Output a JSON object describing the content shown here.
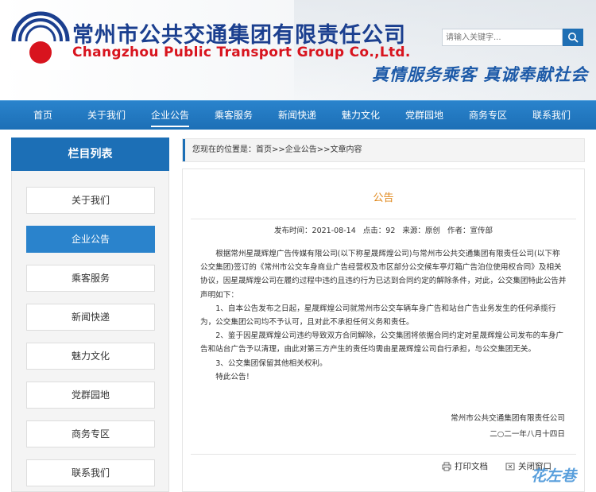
{
  "header": {
    "title_cn": "常州市公共交通集团有限责任公司",
    "title_en": "Changzhou Public Transport Group Co.,Ltd.",
    "search_placeholder": "请输入关键字...",
    "slogan": "真情服务乘客 真诚奉献社会",
    "logo_icon": "circle-logo-icon",
    "brand_blue": "#1b3f8f",
    "brand_red": "#d8141e"
  },
  "nav": {
    "items": [
      "首页",
      "关于我们",
      "企业公告",
      "乘客服务",
      "新闻快递",
      "魅力文化",
      "党群园地",
      "商务专区",
      "联系我们"
    ],
    "active_index": 2
  },
  "sidebar": {
    "heading": "栏目列表",
    "items": [
      "关于我们",
      "企业公告",
      "乘客服务",
      "新闻快递",
      "魅力文化",
      "党群园地",
      "商务专区",
      "联系我们"
    ],
    "active_index": 1
  },
  "breadcrumb": "您现在的位置是：首页>>企业公告>>文章内容",
  "article": {
    "title": "公告",
    "meta": {
      "date": "发布时间：2021-08-14",
      "clicks": "点击：92",
      "source": "来源：原创",
      "author": "作者：宣传部"
    },
    "paragraphs": [
      "根据常州星晟辉煌广告传媒有限公司(以下称星晟辉煌公司)与常州市公共交通集团有限责任公司(以下称公交集团)签订的《常州市公交车身商业广告经营权及市区部分公交候车亭灯箱广告泊位使用权合同》及相关协议，因星晟辉煌公司在履约过程中违约且违约行为已达到合同约定的解除条件，对此，公交集团特此公告并声明如下：",
      "1、自本公告发布之日起，星晟辉煌公司就常州市公交车辆车身广告和站台广告业务发生的任何承揽行为，公交集团公司均不予认可，且对此不承担任何义务和责任。",
      "2、鉴于因星晟辉煌公司违约导致双方合同解除，公交集团将依据合同约定对星晟辉煌公司发布的车身广告和站台广告予以清理，由此对第三方产生的责任均需由星晟辉煌公司自行承担，与公交集团无关。",
      "3、公交集团保留其他相关权利。",
      "特此公告！"
    ],
    "signature_org": "常州市公共交通集团有限责任公司",
    "signature_date": "二○二一年八月十四日"
  },
  "actions": {
    "print": "打印文档",
    "close": "关闭窗口"
  },
  "watermark": "花左巷"
}
